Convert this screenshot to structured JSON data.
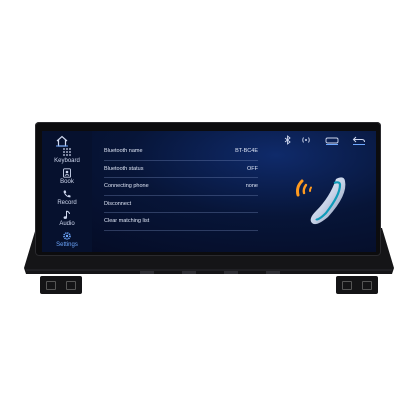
{
  "sidebar": {
    "items": [
      {
        "label": "Keyboard",
        "icon": "keypad-icon"
      },
      {
        "label": "Book",
        "icon": "phonebook-icon"
      },
      {
        "label": "Record",
        "icon": "call-record-icon"
      },
      {
        "label": "Audio",
        "icon": "music-note-icon"
      },
      {
        "label": "Settings",
        "icon": "gear-icon",
        "active": true
      }
    ]
  },
  "settings": {
    "rows": [
      {
        "label": "Bluetooth name",
        "value": "BT-BC4E"
      },
      {
        "label": "Bluetooth status",
        "value": "OFF"
      },
      {
        "label": "Connecting phone",
        "value": "none"
      },
      {
        "label": "Disconnect",
        "value": ""
      },
      {
        "label": "Clear matching list",
        "value": ""
      }
    ]
  },
  "statusbar": {
    "icons": [
      "bluetooth-icon",
      "signal-icon",
      "car-icon",
      "back-icon"
    ]
  },
  "colors": {
    "accent": "#6ea8ff",
    "screen_bg": "#071538",
    "text": "#dfe6f6"
  }
}
